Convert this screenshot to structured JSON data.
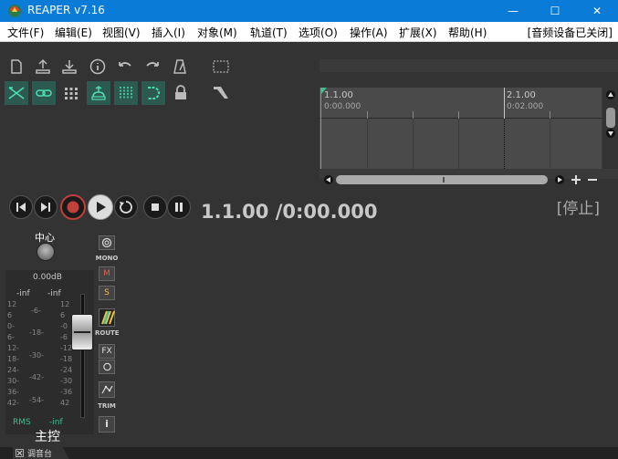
{
  "window": {
    "title": "REAPER v7.16",
    "minimize": "—",
    "maximize": "☐",
    "close": "✕"
  },
  "menu": {
    "items": [
      "文件(F)",
      "编辑(E)",
      "视图(V)",
      "插入(I)",
      "对象(M)",
      "轨道(T)",
      "选项(O)",
      "操作(A)",
      "扩展(X)",
      "帮助(H)"
    ],
    "audio_status": "[音频设备已关闭]"
  },
  "ruler": {
    "marker1_label": "1.1.00",
    "marker1_time": "0:00.000",
    "marker2_label": "2.1.00",
    "marker2_time": "0:02.000"
  },
  "transport": {
    "time": "1.1.00 /0:00.000",
    "state": "[停止]"
  },
  "mixer": {
    "center": "中心",
    "db": "0.00dB",
    "left_peak": "-inf",
    "right_peak": "-inf",
    "scale_left": [
      "12",
      "6",
      "0-",
      "6-",
      "12-",
      "18-",
      "24-",
      "30-",
      "36-",
      "42-"
    ],
    "scale_mid_l": [
      "-6-",
      "-18-",
      "-30-",
      "-42-",
      "-54-"
    ],
    "scale_mid_r": [
      "12",
      "6",
      "-0",
      "-6",
      "-12",
      "-18",
      "-24",
      "-30",
      "-36",
      "42"
    ],
    "rms_label": "RMS",
    "rms_value": "-inf",
    "master": "主控",
    "mono": "MONO",
    "mute": "M",
    "solo": "S",
    "route": "ROUTE",
    "fx": "FX",
    "trim": "TRIM",
    "info": "i"
  },
  "docker": {
    "tab": "调音台"
  },
  "colors": {
    "titlebar": "#0a7bd7",
    "accent_green": "#3fbf8f",
    "record_red": "#c0403a"
  }
}
